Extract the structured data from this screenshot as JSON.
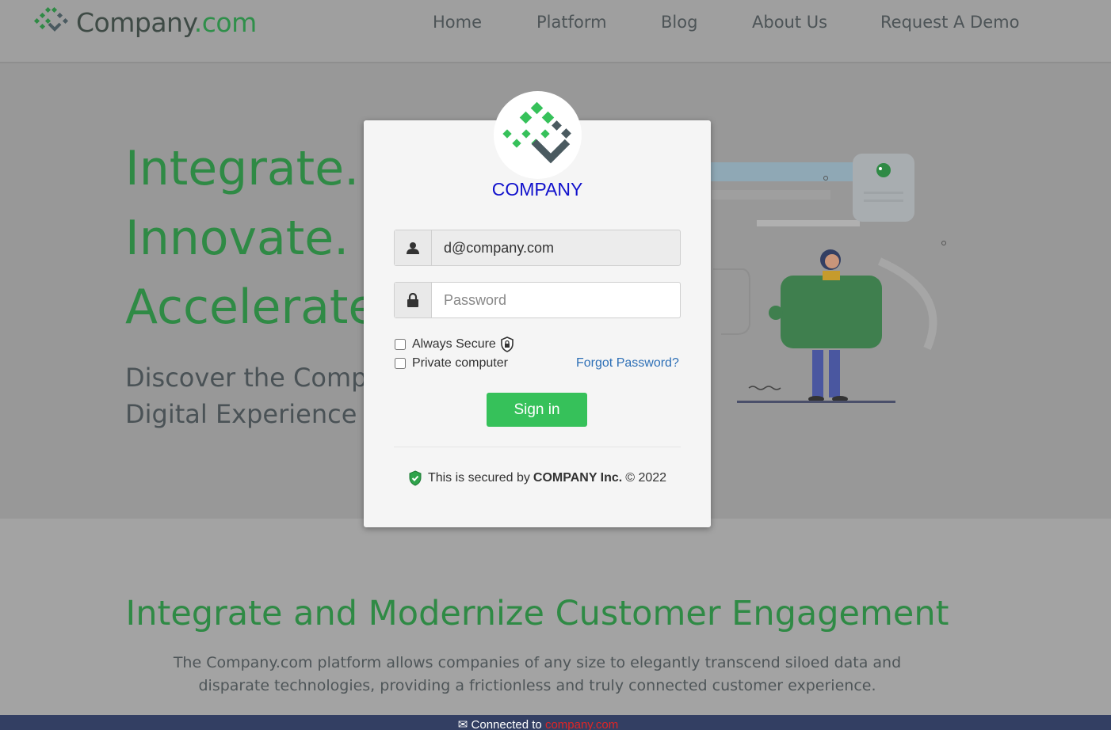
{
  "header": {
    "brand_name": "Company",
    "brand_tld": ".com",
    "nav": [
      {
        "label": "Home"
      },
      {
        "label": "Platform"
      },
      {
        "label": "Blog"
      },
      {
        "label": "About Us"
      },
      {
        "label": "Request A Demo"
      }
    ]
  },
  "hero": {
    "lines": [
      "Integrate.",
      "Innovate.",
      "Accelerate."
    ],
    "subtitle_line1": "Discover the Compa",
    "subtitle_line2": "Digital Experience F"
  },
  "login": {
    "brand": "COMPANY",
    "email_value": "d@company.com",
    "password_placeholder": "Password",
    "always_secure_label": "Always Secure",
    "private_computer_label": "Private computer",
    "forgot_password": "Forgot Password?",
    "sign_in": "Sign in",
    "secured_prefix": "This is secured by",
    "secured_company": "COMPANY Inc.",
    "secured_suffix": "© 2022",
    "colors": {
      "brand": "#1010cc",
      "sign_in": "#36c15a",
      "link": "#2d6fb6"
    }
  },
  "section2": {
    "title": "Integrate and Modernize Customer Engagement",
    "body": "The Company.com platform allows companies of any size to elegantly transcend siloed data and disparate technologies, providing a frictionless and truly connected customer experience."
  },
  "footer": {
    "connected_prefix": "Connected to",
    "connected_link": "company.com"
  },
  "icons": [
    "company-logo-icon",
    "user-icon",
    "lock-icon",
    "shield-lock-icon",
    "shield-check-icon",
    "mail-icon"
  ]
}
